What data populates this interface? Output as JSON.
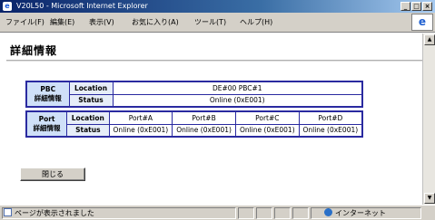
{
  "window": {
    "title": "V20L50 - Microsoft Internet Explorer",
    "logo": "e",
    "minimize": "_",
    "maximize": "□",
    "close": "×"
  },
  "menubar": {
    "items": [
      "ファイル(F)",
      "編集(E)",
      "表示(V)",
      "お気に入り(A)",
      "ツール(T)",
      "ヘルプ(H)"
    ]
  },
  "page": {
    "title": "詳細情報"
  },
  "pbc": {
    "header": "PBC",
    "header_sub": "詳細情報",
    "location_label": "Location",
    "location_value": "DE#00 PBC#1",
    "status_label": "Status",
    "status_value": "Online (0xE001)"
  },
  "port": {
    "header": "Port",
    "header_sub": "詳細情報",
    "location_label": "Location",
    "status_label": "Status",
    "ports": [
      {
        "location": "Port#A",
        "status": "Online (0xE001)"
      },
      {
        "location": "Port#B",
        "status": "Online (0xE001)"
      },
      {
        "location": "Port#C",
        "status": "Online (0xE001)"
      },
      {
        "location": "Port#D",
        "status": "Online (0xE001)"
      }
    ]
  },
  "buttons": {
    "close": "閉じる"
  },
  "statusbar": {
    "message": "ページが表示されました",
    "zone": "インターネット"
  }
}
